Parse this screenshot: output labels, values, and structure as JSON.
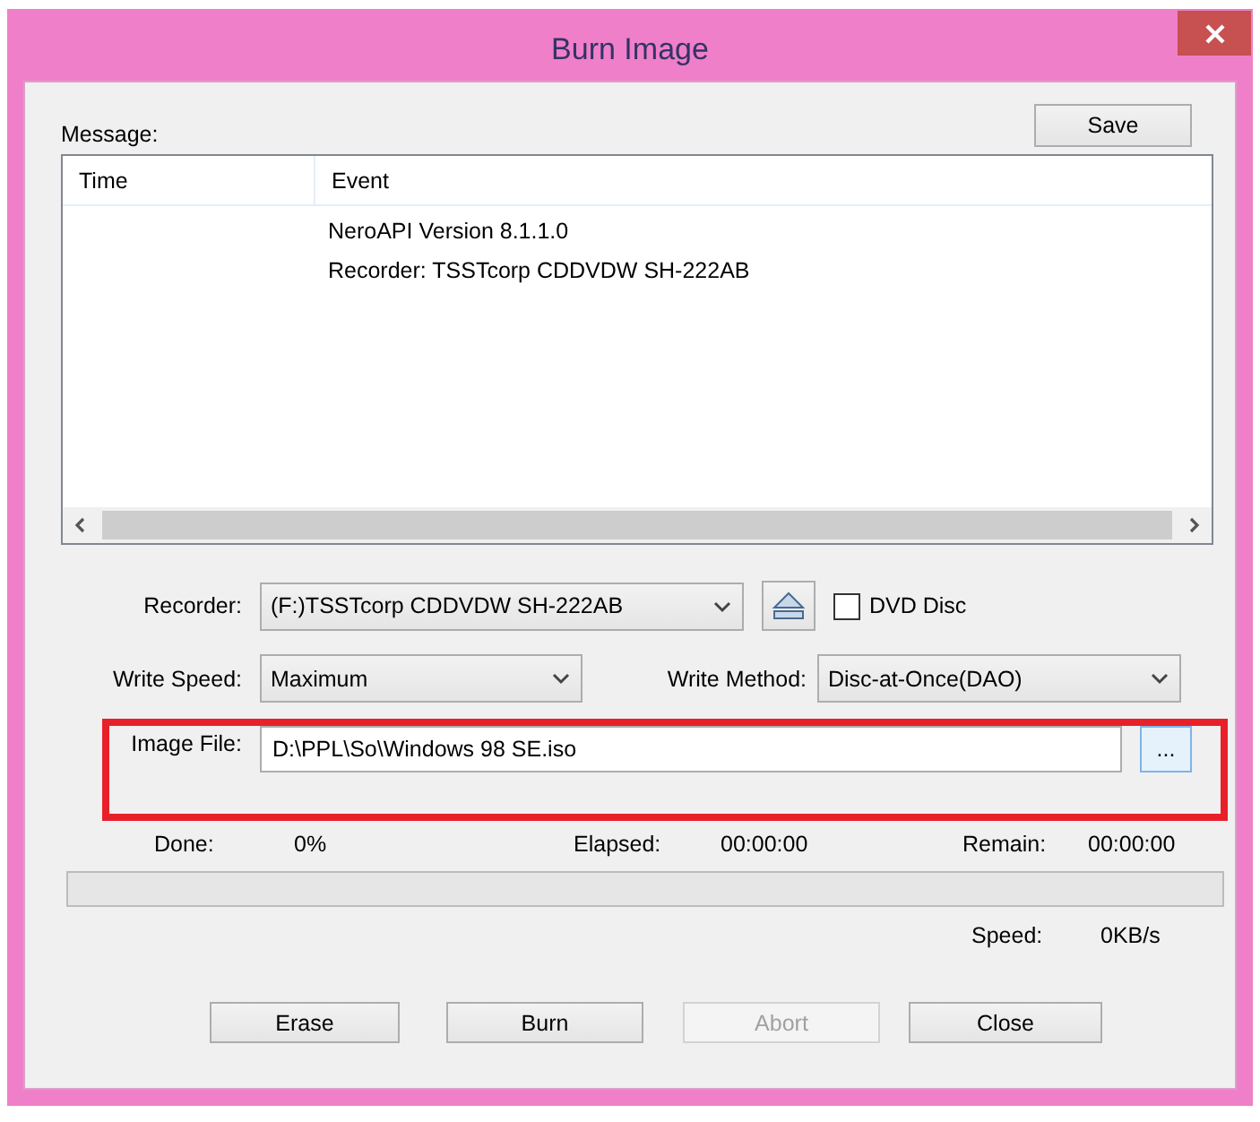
{
  "window": {
    "title": "Burn Image"
  },
  "message": {
    "label": "Message:",
    "save_button": "Save",
    "columns": [
      "Time",
      "Event"
    ],
    "rows": [
      {
        "event": "NeroAPI Version 8.1.1.0"
      },
      {
        "event": "Recorder: TSSTcorp CDDVDW SH-222AB"
      }
    ]
  },
  "recorder": {
    "label": "Recorder:",
    "value": "(F:)TSSTcorp CDDVDW SH-222AB"
  },
  "dvd_disc": {
    "label": "DVD Disc",
    "checked": false
  },
  "write_speed": {
    "label": "Write Speed:",
    "value": "Maximum"
  },
  "write_method": {
    "label": "Write Method:",
    "value": "Disc-at-Once(DAO)"
  },
  "image_file": {
    "label": "Image File:",
    "value": "D:\\PPL\\So\\Windows 98 SE.iso",
    "browse_button": "...",
    "highlighted": true
  },
  "progress": {
    "done_label": "Done:",
    "done": "0%",
    "elapsed_label": "Elapsed:",
    "elapsed": "00:00:00",
    "remain_label": "Remain:",
    "remain": "00:00:00",
    "level": 0,
    "speed_label": "Speed:",
    "speed": "0KB/s"
  },
  "buttons": [
    {
      "label": "Erase",
      "disabled": false
    },
    {
      "label": "Burn",
      "disabled": false
    },
    {
      "label": "Abort",
      "disabled": true
    },
    {
      "label": "Close",
      "disabled": false
    }
  ]
}
